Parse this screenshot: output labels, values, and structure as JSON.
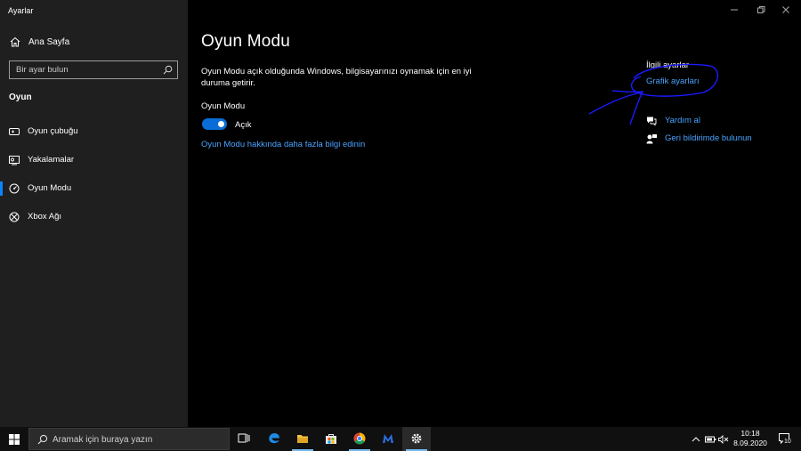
{
  "window": {
    "title": "Ayarlar"
  },
  "sidebar": {
    "home_label": "Ana Sayfa",
    "search_placeholder": "Bir ayar bulun",
    "section_title": "Oyun",
    "items": [
      {
        "label": "Oyun çubuğu",
        "icon": "game-bar-icon"
      },
      {
        "label": "Yakalamalar",
        "icon": "captures-icon"
      },
      {
        "label": "Oyun Modu",
        "icon": "game-mode-icon",
        "active": true
      },
      {
        "label": "Xbox Ağı",
        "icon": "xbox-icon"
      }
    ]
  },
  "main": {
    "title": "Oyun Modu",
    "description": "Oyun Modu açık olduğunda Windows, bilgisayarınızı oynamak için en iyi duruma getirir.",
    "setting_label": "Oyun Modu",
    "toggle_on": true,
    "toggle_state": "Açık",
    "learn_more": "Oyun Modu hakkında daha fazla bilgi edinin"
  },
  "related": {
    "heading": "İlgili ayarlar",
    "link": "Grafik ayarları",
    "help": "Yardım al",
    "feedback": "Geri bildirimde bulunun"
  },
  "taskbar": {
    "search_text": "Aramak için buraya yazın",
    "time": "10:18",
    "date": "8.09.2020",
    "notification_count": "10"
  },
  "colors": {
    "accent": "#0a6cd6",
    "link": "#4aa3ff",
    "sidebar_bg": "#1f1f1f",
    "main_bg": "#000000",
    "annotation_ink": "#1a1aff"
  }
}
